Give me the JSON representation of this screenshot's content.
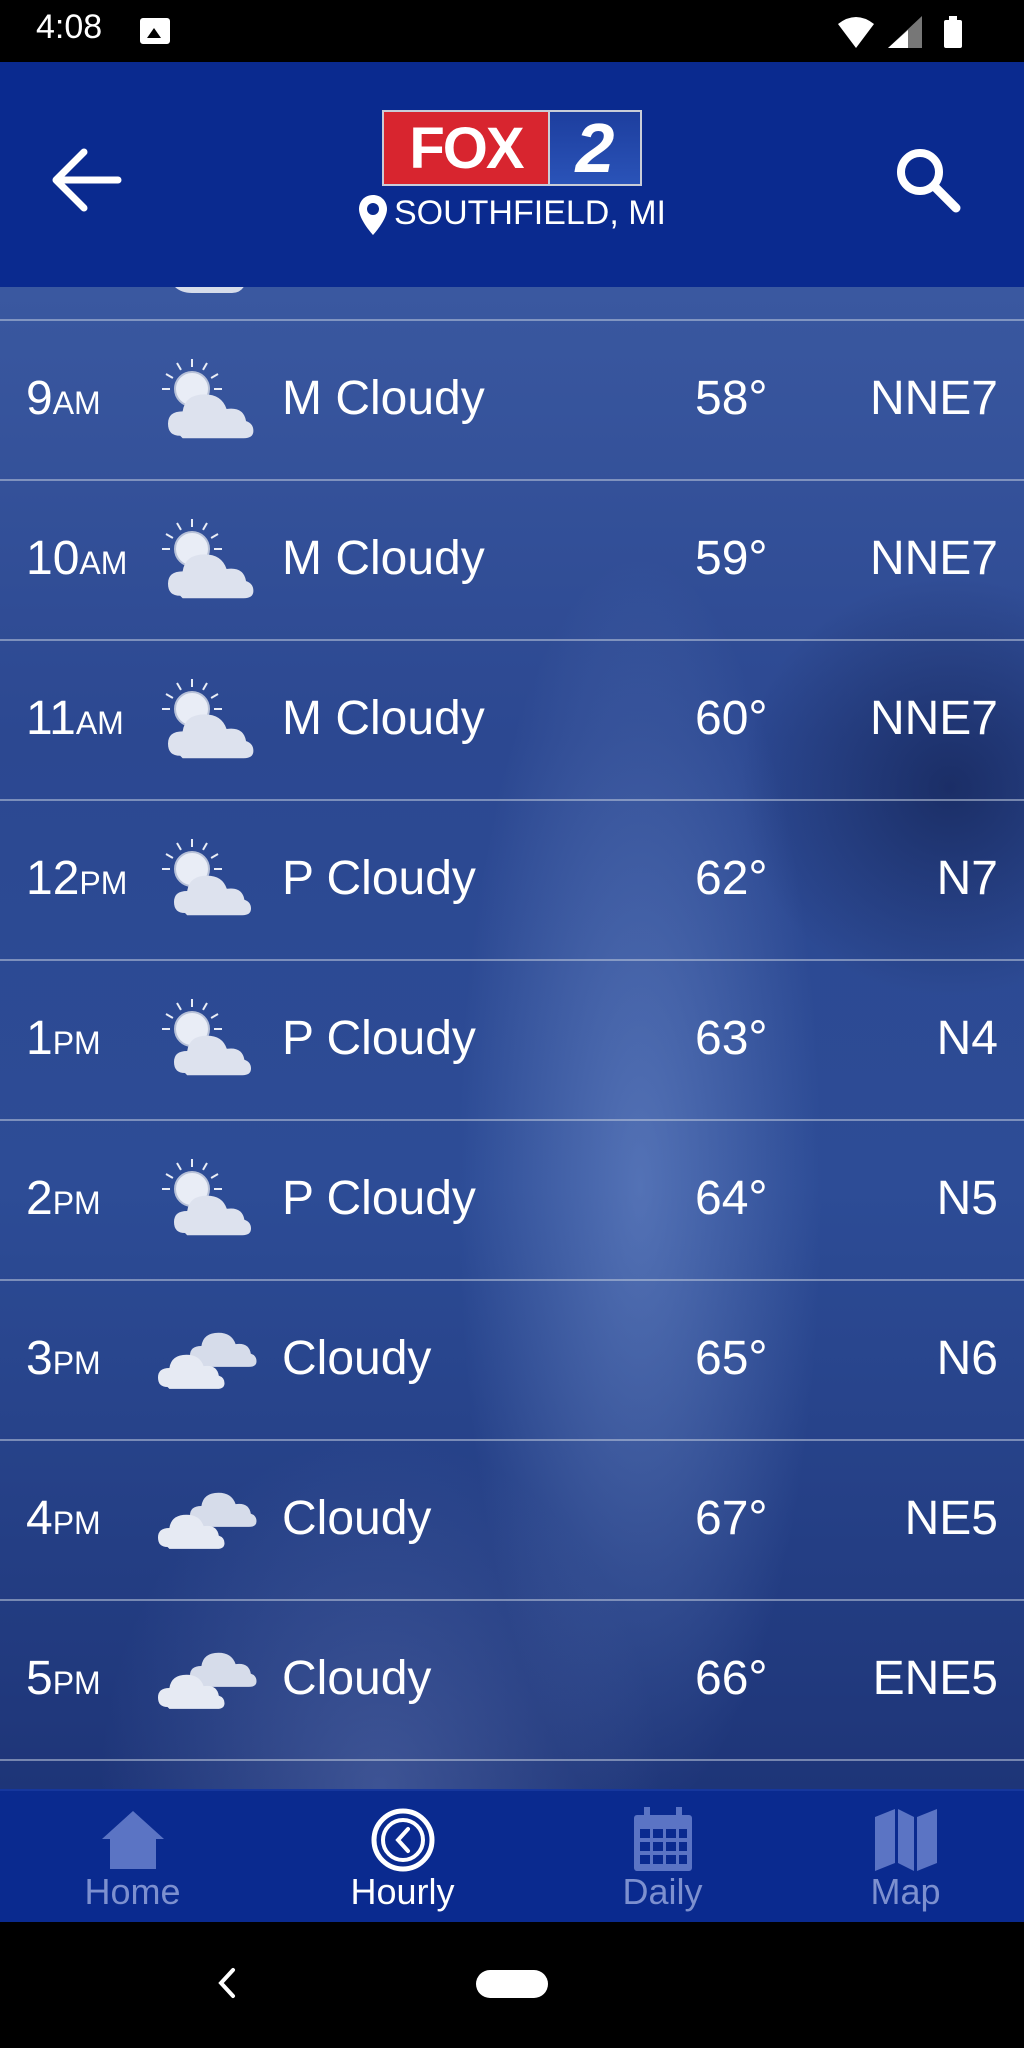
{
  "status_bar": {
    "time": "4:08"
  },
  "header": {
    "logo_fox": "FOX",
    "logo_number": "2",
    "location": "SOUTHFIELD, MI"
  },
  "hourly": [
    {
      "hour": "9",
      "period": "AM",
      "icon": "mostly-cloudy-icon",
      "condition": "M Cloudy",
      "temp": "58°",
      "wind": "NNE7"
    },
    {
      "hour": "10",
      "period": "AM",
      "icon": "mostly-cloudy-icon",
      "condition": "M Cloudy",
      "temp": "59°",
      "wind": "NNE7"
    },
    {
      "hour": "11",
      "period": "AM",
      "icon": "mostly-cloudy-icon",
      "condition": "M Cloudy",
      "temp": "60°",
      "wind": "NNE7"
    },
    {
      "hour": "12",
      "period": "PM",
      "icon": "partly-cloudy-icon",
      "condition": "P Cloudy",
      "temp": "62°",
      "wind": "N7"
    },
    {
      "hour": "1",
      "period": "PM",
      "icon": "partly-cloudy-icon",
      "condition": "P Cloudy",
      "temp": "63°",
      "wind": "N4"
    },
    {
      "hour": "2",
      "period": "PM",
      "icon": "partly-cloudy-icon",
      "condition": "P Cloudy",
      "temp": "64°",
      "wind": "N5"
    },
    {
      "hour": "3",
      "period": "PM",
      "icon": "cloudy-icon",
      "condition": "Cloudy",
      "temp": "65°",
      "wind": "N6"
    },
    {
      "hour": "4",
      "period": "PM",
      "icon": "cloudy-icon",
      "condition": "Cloudy",
      "temp": "67°",
      "wind": "NE5"
    },
    {
      "hour": "5",
      "period": "PM",
      "icon": "cloudy-icon",
      "condition": "Cloudy",
      "temp": "66°",
      "wind": "ENE5"
    }
  ],
  "bottom_nav": {
    "items": [
      {
        "label": "Home",
        "icon": "home-icon",
        "active": false
      },
      {
        "label": "Hourly",
        "icon": "clock-icon",
        "active": true
      },
      {
        "label": "Daily",
        "icon": "calendar-icon",
        "active": false
      },
      {
        "label": "Map",
        "icon": "map-icon",
        "active": false
      }
    ]
  },
  "colors": {
    "header_bg": "#0a2a8f",
    "nav_inactive": "#7d90cf",
    "fox_red": "#d8252f"
  }
}
